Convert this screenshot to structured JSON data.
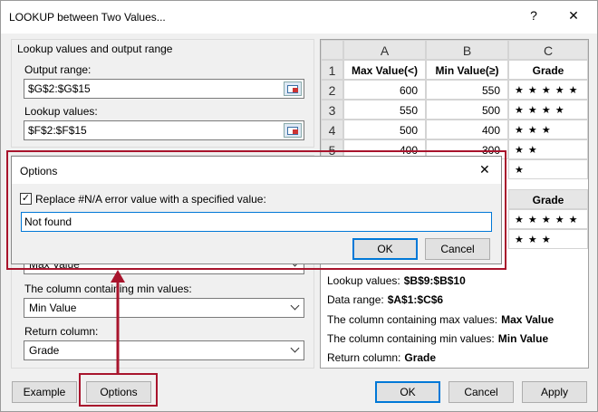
{
  "window": {
    "title": "LOOKUP between Two Values...",
    "help": "?",
    "close": "✕"
  },
  "left": {
    "group_title": "Lookup values and output range",
    "output_label": "Output range:",
    "output_value": "$G$2:$G$15",
    "lookup_label": "Lookup values:",
    "lookup_value": "$F$2:$F$15",
    "max_select_value": "Max Value",
    "min_label": "The column containing min values:",
    "min_value": "Min Value",
    "return_label": "Return column:",
    "return_value": "Grade"
  },
  "sheet": {
    "col_headers": [
      "A",
      "B",
      "C"
    ],
    "rows": [
      {
        "num": "1",
        "a": "Max Value(<)",
        "b": "Min Value(≥)",
        "c": "Grade"
      },
      {
        "num": "2",
        "a": "600",
        "b": "550",
        "c": "★ ★ ★ ★ ★"
      },
      {
        "num": "3",
        "a": "550",
        "b": "500",
        "c": "★ ★ ★ ★"
      },
      {
        "num": "4",
        "a": "500",
        "b": "400",
        "c": "★ ★ ★"
      },
      {
        "num": "5",
        "a": "400",
        "b": "300",
        "c": "★ ★"
      },
      {
        "num": "",
        "a": "",
        "b": "",
        "c": "★"
      }
    ],
    "grade_header": "Grade",
    "grade_rows": [
      "★ ★ ★ ★ ★",
      "★ ★ ★"
    ]
  },
  "info": {
    "lookup_label": "Lookup values:",
    "lookup_value": "$B$9:$B$10",
    "data_label": "Data range:",
    "data_value": "$A$1:$C$6",
    "max_label": "The column containing max values:",
    "max_value": "Max Value",
    "min_label": "The column containing min values:",
    "min_value": "Min Value",
    "return_label": "Return column:",
    "return_value": "Grade"
  },
  "buttons": {
    "example": "Example",
    "options": "Options",
    "ok": "OK",
    "cancel": "Cancel",
    "apply": "Apply"
  },
  "options_dialog": {
    "title": "Options",
    "close": "✕",
    "checkbox_label": "Replace #N/A error value with a specified value:",
    "checkbox_checked": true,
    "input_value": "Not found",
    "ok": "OK",
    "cancel": "Cancel"
  },
  "colors": {
    "highlight": "#a8142c",
    "accent": "#0078d7"
  }
}
